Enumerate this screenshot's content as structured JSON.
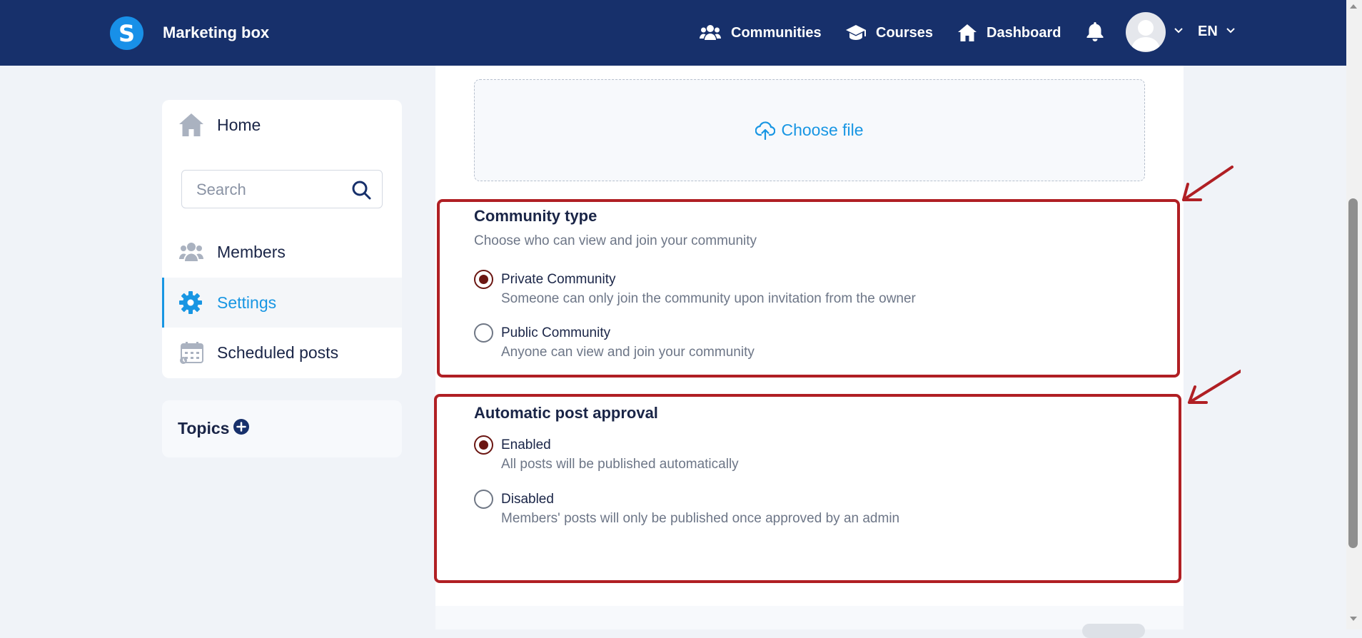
{
  "header": {
    "logo_letter": "S",
    "brand": "Marketing box",
    "nav": [
      {
        "label": "Communities",
        "icon": "users-icon"
      },
      {
        "label": "Courses",
        "icon": "graduation-cap-icon"
      },
      {
        "label": "Dashboard",
        "icon": "home-icon"
      }
    ],
    "notifications_icon": "bell-icon",
    "language": "EN"
  },
  "sidebar": {
    "items": [
      {
        "label": "Home",
        "icon": "home-icon"
      },
      {
        "label": "Members",
        "icon": "members-icon"
      },
      {
        "label": "Settings",
        "icon": "gear-icon",
        "active": true
      },
      {
        "label": "Scheduled posts",
        "icon": "calendar-icon"
      }
    ],
    "search_placeholder": "Search",
    "topics_label": "Topics"
  },
  "main": {
    "upload_label": "Choose file",
    "community_type": {
      "title": "Community type",
      "subtitle": "Choose who can view and join your community",
      "options": [
        {
          "label": "Private Community",
          "description": "Someone can only join the community upon invitation from the owner",
          "checked": true
        },
        {
          "label": "Public Community",
          "description": "Anyone can view and join your community",
          "checked": false
        }
      ]
    },
    "post_approval": {
      "title": "Automatic post approval",
      "options": [
        {
          "label": "Enabled",
          "description": "All posts will be published automatically",
          "checked": true
        },
        {
          "label": "Disabled",
          "description": "Members' posts will only be published once approved by an admin",
          "checked": false
        }
      ]
    }
  },
  "colors": {
    "nav_bg": "#17306b",
    "accent": "#1896e3",
    "highlight": "#b01f24",
    "radio_checked": "#6b1612"
  }
}
